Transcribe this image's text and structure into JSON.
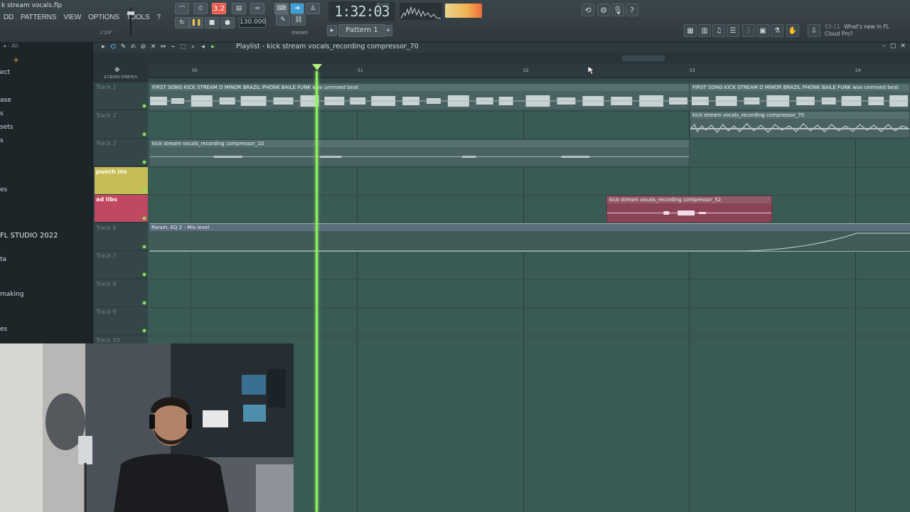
{
  "toolbar": {
    "project_title": "k stream vocals.flp",
    "menus": [
      "DD",
      "PATTERNS",
      "VIEW",
      "OPTIONS",
      "TOOLS",
      "?"
    ],
    "hint": "1'29\"",
    "pat_song_label": "3.2",
    "tempo": "130.000",
    "time": "1:32:03",
    "time_unit": "M:S:CS",
    "pattern": "Pattern 1",
    "pattern_none": "(none)",
    "news_date": "03-11",
    "news_text": "What's new in FL Cloud Pro?"
  },
  "browser": {
    "header": "All",
    "items": [
      "ect",
      "ase",
      "s",
      "sets",
      "s",
      "es",
      "FL STUDIO 2022",
      "ta",
      "making",
      "es"
    ]
  },
  "playlist": {
    "title": "Playlist - kick stream vocals_recording compressor_70",
    "ruler": [
      "50",
      "51",
      "52",
      "53",
      "54"
    ],
    "zoom_labels": "Z-CROSS  STRETCH",
    "tracks": [
      "Track 1",
      "Track 2",
      "Track 3",
      "punch ins",
      "ad libs",
      "Track 6",
      "Track 7",
      "Track 8",
      "Track 9",
      "Track 10"
    ],
    "clips": {
      "beat_a": "FIRST SONG KICK STREAM D MINOR BRAZIL PHONK BAILE FUNK wav unmixed beat",
      "beat_b": "FIRST SONG KICK STREAM D MINOR BRAZIL PHONK BAILE FUNK wav unmixed beat",
      "vox70": "kick stream vocals_recording compressor_70",
      "vox10": "kick stream vocals_recording compressor_10",
      "vox52": "kick stream vocals_recording compressor_52",
      "auto": "Param. EQ 2 - Mix level"
    }
  },
  "colors": {
    "playhead": "#8ff25d",
    "punch_ins": "#c7bd55",
    "ad_libs": "#c04860"
  }
}
